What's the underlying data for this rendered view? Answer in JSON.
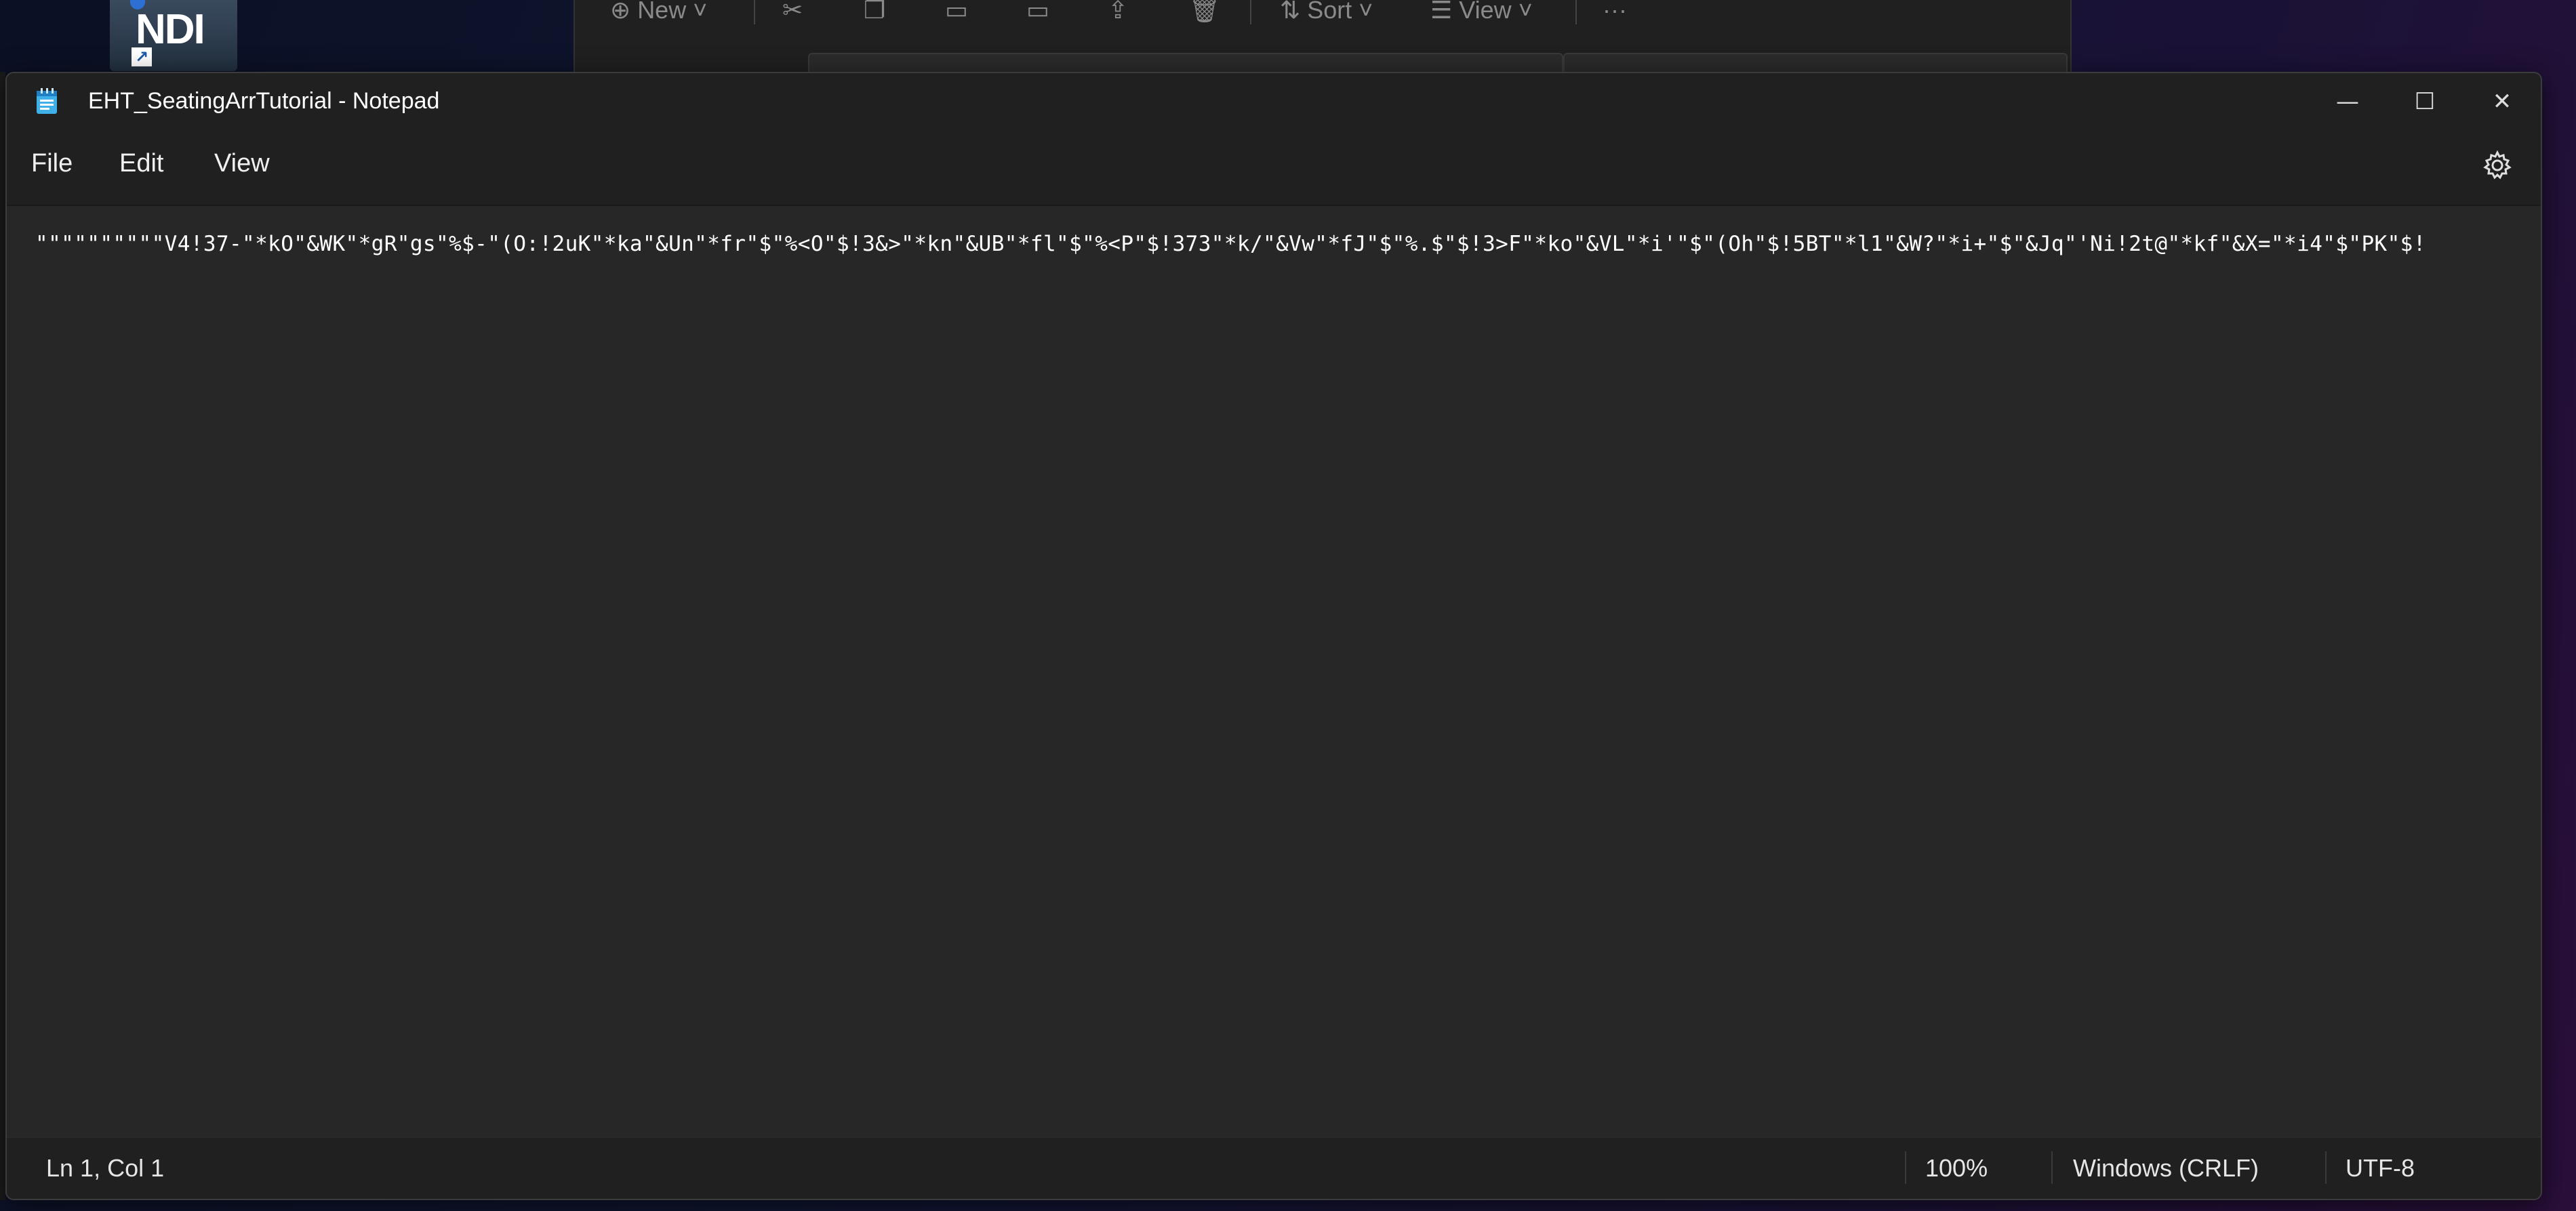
{
  "desktop": {
    "shortcut_label": "NDI",
    "shortcut_arrow": "↗"
  },
  "explorer": {
    "new_label": "New",
    "sort_label": "Sort",
    "view_label": "View",
    "more_label": "···"
  },
  "notepad": {
    "title": "EHT_SeatingArrTutorial - Notepad",
    "window_controls": {
      "minimize": "—",
      "maximize": "☐",
      "close": "✕"
    },
    "menu": {
      "file": "File",
      "edit": "Edit",
      "view": "View"
    },
    "content": "\"\"\"\"\"\"\"\"\"\"V4!37-\"*kO\"&WK\"*gR\"gs\"%$-\"(O:!2uK\"*ka\"&Un\"*fr\"$\"%<O\"$!3&>\"*kn\"&UB\"*fl\"$\"%<P\"$!373\"*k/\"&Vw\"*fJ\"$\"%.$\"$!3>F\"*ko\"&VL\"*i'\"$\"(Oh\"$!5BT\"*l1\"&W?\"*i+\"$\"&Jq\"'Ni!2t@\"*kf\"&X=\"*i4\"$\"PK\"$!",
    "status": {
      "position": "Ln 1, Col 1",
      "zoom": "100%",
      "line_ending": "Windows (CRLF)",
      "encoding": "UTF-8"
    }
  }
}
